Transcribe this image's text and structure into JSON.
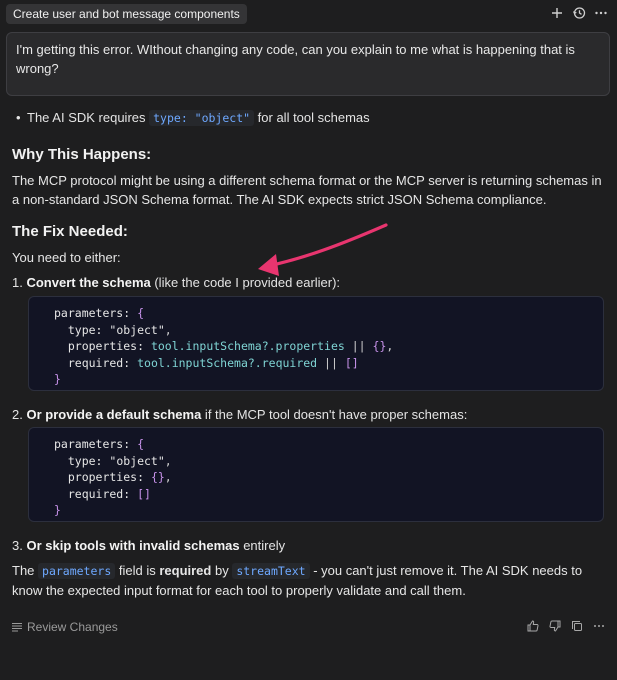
{
  "header": {
    "title": "Create user and bot message components",
    "icons": [
      "plus-icon",
      "history-icon",
      "more-icon"
    ]
  },
  "user_message": "I'm getting this error. WIthout changing any code, can you explain to me what is happening that is wrong?",
  "assistant": {
    "bullet": {
      "before": "The AI SDK requires ",
      "code": "type: \"object\"",
      "after": " for all tool schemas"
    },
    "why_heading": "Why This Happens:",
    "why_text": "The MCP protocol might be using a different schema format or the MCP server is returning schemas in a non-standard JSON Schema format. The AI SDK expects strict JSON Schema compliance.",
    "fix_heading": "The Fix Needed:",
    "intro": "You need to either:",
    "item1": {
      "num": "1.",
      "bold": "Convert the schema",
      "rest": " (like the code I provided earlier):"
    },
    "code1": [
      "parameters: {",
      "  type: \"object\",",
      "  properties: tool.inputSchema?.properties || {},",
      "  required: tool.inputSchema?.required || []",
      "}"
    ],
    "item2": {
      "num": "2.",
      "bold": "Or provide a default schema",
      "rest": " if the MCP tool doesn't have proper schemas:"
    },
    "code2": [
      "parameters: {",
      "  type: \"object\",",
      "  properties: {},",
      "  required: []",
      "}"
    ],
    "item3": {
      "num": "3.",
      "bold": "Or skip tools with invalid schemas",
      "rest": " entirely"
    },
    "final": {
      "t1": "The ",
      "c1": "parameters",
      "t2": " field is ",
      "b1": "required",
      "t3": " by ",
      "c2": "streamText",
      "t4": " - you can't just remove it. The AI SDK needs to know the expected input format for each tool to properly validate and call them."
    }
  },
  "footer": {
    "review_label": "Review Changes",
    "icons": [
      "thumbs-up-icon",
      "thumbs-down-icon",
      "copy-icon",
      "more-icon"
    ]
  },
  "colors": {
    "background": "#1e1e1f",
    "code_bg": "#121424",
    "inline_code": "#6ea8ff",
    "arrow": "#e8356f"
  }
}
